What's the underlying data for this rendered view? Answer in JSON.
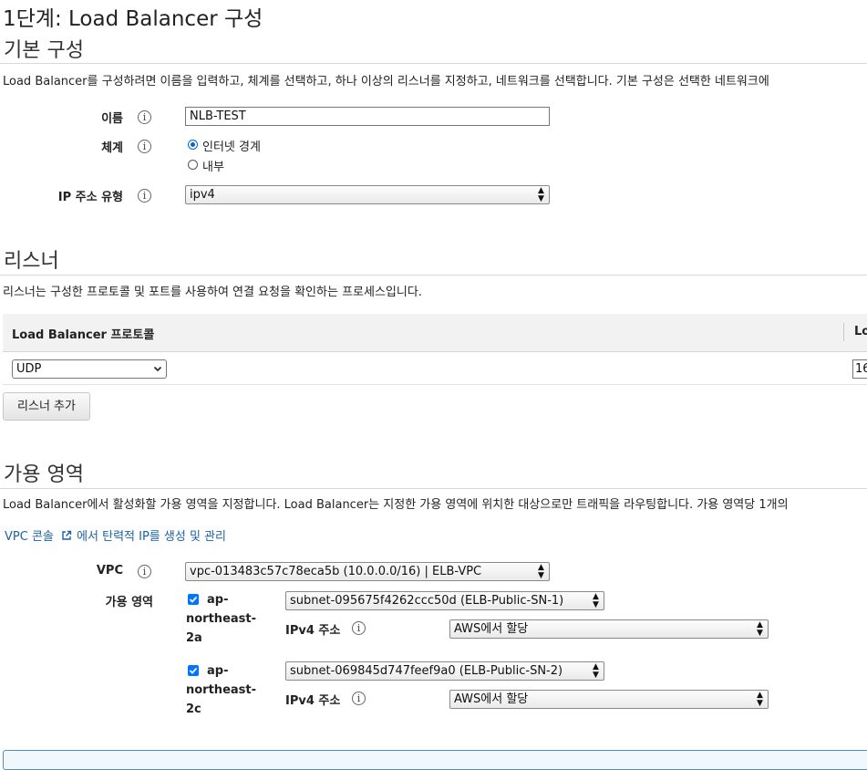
{
  "page": {
    "title": "1단계: Load Balancer 구성"
  },
  "basic": {
    "heading": "기본 구성",
    "description": "Load Balancer를 구성하려면 이름을 입력하고, 체계를 선택하고, 하나 이상의 리스너를 지정하고, 네트워크를 선택합니다. 기본 구성은 선택한 네트워크에",
    "name_label": "이름",
    "name_value": "NLB-TEST",
    "scheme_label": "체계",
    "scheme_options": [
      "인터넷 경계",
      "내부"
    ],
    "scheme_selected": "인터넷 경계",
    "ip_type_label": "IP 주소 유형",
    "ip_type_value": "ipv4"
  },
  "listeners": {
    "heading": "리스너",
    "description": "리스너는 구성한 프로토콜 및 포트를 사용하여 연결 요청을 확인하는 프로세스입니다.",
    "col_protocol": "Load Balancer 프로토콜",
    "col_port_partial": "Lo",
    "protocol_value": "UDP",
    "port_value_partial": "16",
    "add_button": "리스너 추가"
  },
  "az": {
    "heading": "가용 영역",
    "description": "Load Balancer에서 활성화할 가용 영역을 지정합니다. Load Balancer는 지정한 가용 영역에 위치한 대상으로만 트래픽을 라우팅합니다. 가용 영역당 1개의",
    "vpc_link": "VPC 콘솔",
    "vpc_link_suffix": "에서 탄력적 IP를 생성 및 관리",
    "vpc_label": "VPC",
    "vpc_value": "vpc-013483c57c78eca5b (10.0.0.0/16) | ELB-VPC",
    "zones_label": "가용 영역",
    "ipv4_label": "IPv4 주소",
    "zones": [
      {
        "name": "ap-northeast-2a",
        "subnet": "subnet-095675f4262ccc50d (ELB-Public-SN-1)",
        "ipv4": "AWS에서 할당"
      },
      {
        "name": "ap-northeast-2c",
        "subnet": "subnet-069845d747feef9a0 (ELB-Public-SN-2)",
        "ipv4": "AWS에서 할당"
      }
    ]
  },
  "colors": {
    "link": "#1b62a6",
    "accent": "#0075ff"
  }
}
